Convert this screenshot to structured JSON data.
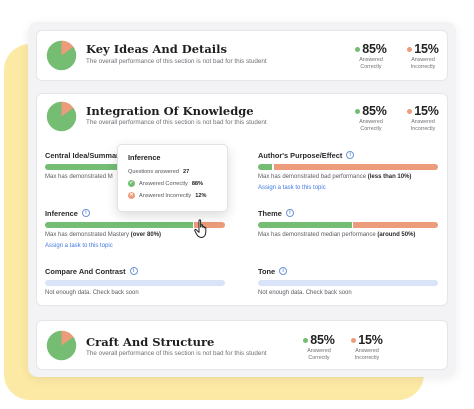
{
  "colors": {
    "correct": "#74bd73",
    "incorrect": "#ec9c7a",
    "nodata": "#d9e4f9",
    "link": "#3f7be0"
  },
  "sections": {
    "key_ideas": {
      "title": "Key Ideas And Details",
      "subtitle": "The overall performance of this section is not bad for this student",
      "correct_pct": "85%",
      "correct_label_1": "Answered",
      "correct_label_2": "Correctly",
      "incorrect_pct": "15%",
      "incorrect_label_1": "Answered",
      "incorrect_label_2": "Incorrectly",
      "correct_fraction": 0.85
    },
    "integration": {
      "title": "Integration Of Knowledge",
      "subtitle": "The overall performance of this section is not bad for this student",
      "correct_pct": "85%",
      "correct_label_1": "Answered",
      "correct_label_2": "Correctly",
      "incorrect_pct": "15%",
      "incorrect_label_1": "Answered",
      "incorrect_label_2": "Incorrectly",
      "correct_fraction": 0.85,
      "topics": {
        "central_idea": {
          "name": "Central Idea/Summary",
          "desc_prefix": "Max has demonstrated M",
          "correct_fraction": 0.7
        },
        "authors_purpose": {
          "name": "Author's Purpose/Effect",
          "desc_prefix": "Max has demonstrated bad performance ",
          "desc_bold": "(less than 10%)",
          "link": "Assign a task to this topic",
          "correct_fraction": 0.08
        },
        "inference": {
          "name": "Inference",
          "desc_prefix": "Max has demonstrated Mastery ",
          "desc_bold": "(over 80%)",
          "link": "Assign a task to this topic",
          "correct_fraction": 0.82
        },
        "theme": {
          "name": "Theme",
          "desc_prefix": "Max has demonstrated median performance ",
          "desc_bold": "(around 50%)",
          "correct_fraction": 0.52
        },
        "compare_contrast": {
          "name": "Compare And Contrast",
          "desc": "Not enough data. Check back soon"
        },
        "tone": {
          "name": "Tone",
          "desc": "Not enough data. Check back soon"
        }
      },
      "tooltip": {
        "title": "Inference",
        "questions_label": "Questions answered",
        "questions_value": "27",
        "correct_label": "Answered Correctly",
        "correct_value": "88%",
        "incorrect_label": "Answered Incorrectly",
        "incorrect_value": "12%"
      }
    },
    "craft": {
      "title": "Craft And Structure",
      "subtitle": "The overall performance of this section is not bad for this student",
      "correct_pct": "85%",
      "correct_label_1": "Answered",
      "correct_label_2": "Correctly",
      "incorrect_pct": "15%",
      "incorrect_label_1": "Answered",
      "incorrect_label_2": "Incorrectly",
      "correct_fraction": 0.85
    }
  }
}
